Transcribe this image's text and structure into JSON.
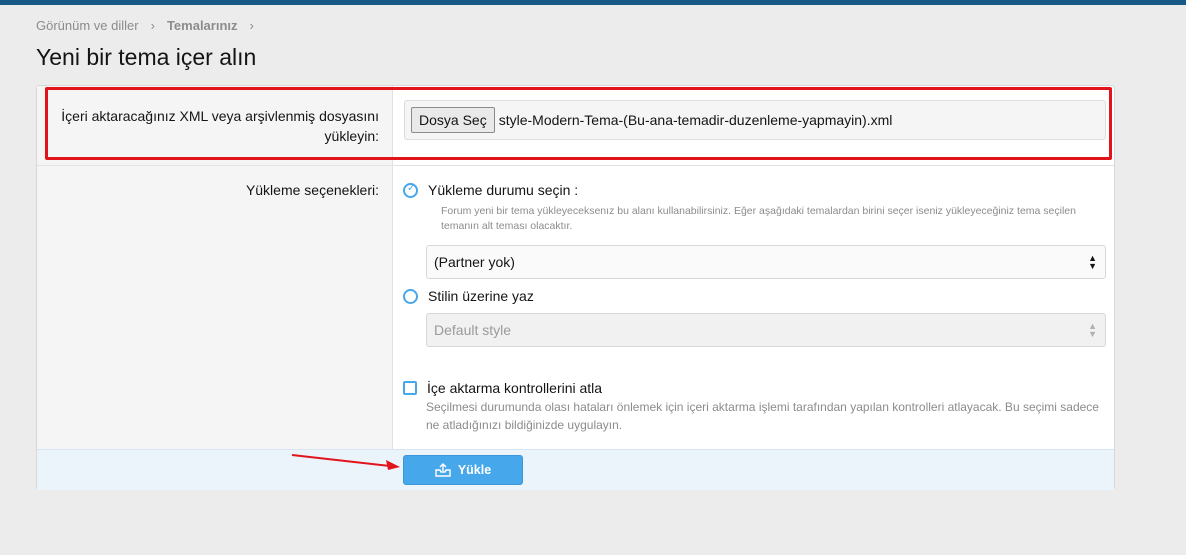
{
  "breadcrumb": {
    "item1": "Görünüm ve diller",
    "item2": "Temalarınız"
  },
  "page": {
    "title": "Yeni bir tema içer alın"
  },
  "file_row": {
    "label": "İçeri aktaracağınız XML veya arşivlenmiş dosyasını yükleyin:",
    "button": "Dosya Seç",
    "file_name": "style-Modern-Tema-(Bu-ana-temadir-duzenleme-yapmayin).xml"
  },
  "options_row": {
    "label": "Yükleme seçenekleri:",
    "radio1": {
      "label": "Yükleme durumu seçin :",
      "hint": "Forum yeni bir tema yükleyeceksenız bu alanı kullanabilirsiniz. Eğer aşağıdaki temalardan birini seçer iseniz yükleyeceğiniz tema seçilen temanın alt teması olacaktır.",
      "select_value": "(Partner yok)"
    },
    "radio2": {
      "label": "Stilin üzerine yaz",
      "select_value": "Default style"
    },
    "checkbox": {
      "label": "İçe aktarma kontrollerini atla",
      "hint": "Seçilmesi durumunda olası hataları önlemek için içeri aktarma işlemi tarafından yapılan kontrolleri atlayacak. Bu seçimi sadece ne atladığınızı bildiğinizde uygulayın."
    }
  },
  "submit": {
    "label": "Yükle"
  },
  "colors": {
    "accent": "#47a7eb",
    "highlight": "#e1141c",
    "topbar": "#185886"
  }
}
